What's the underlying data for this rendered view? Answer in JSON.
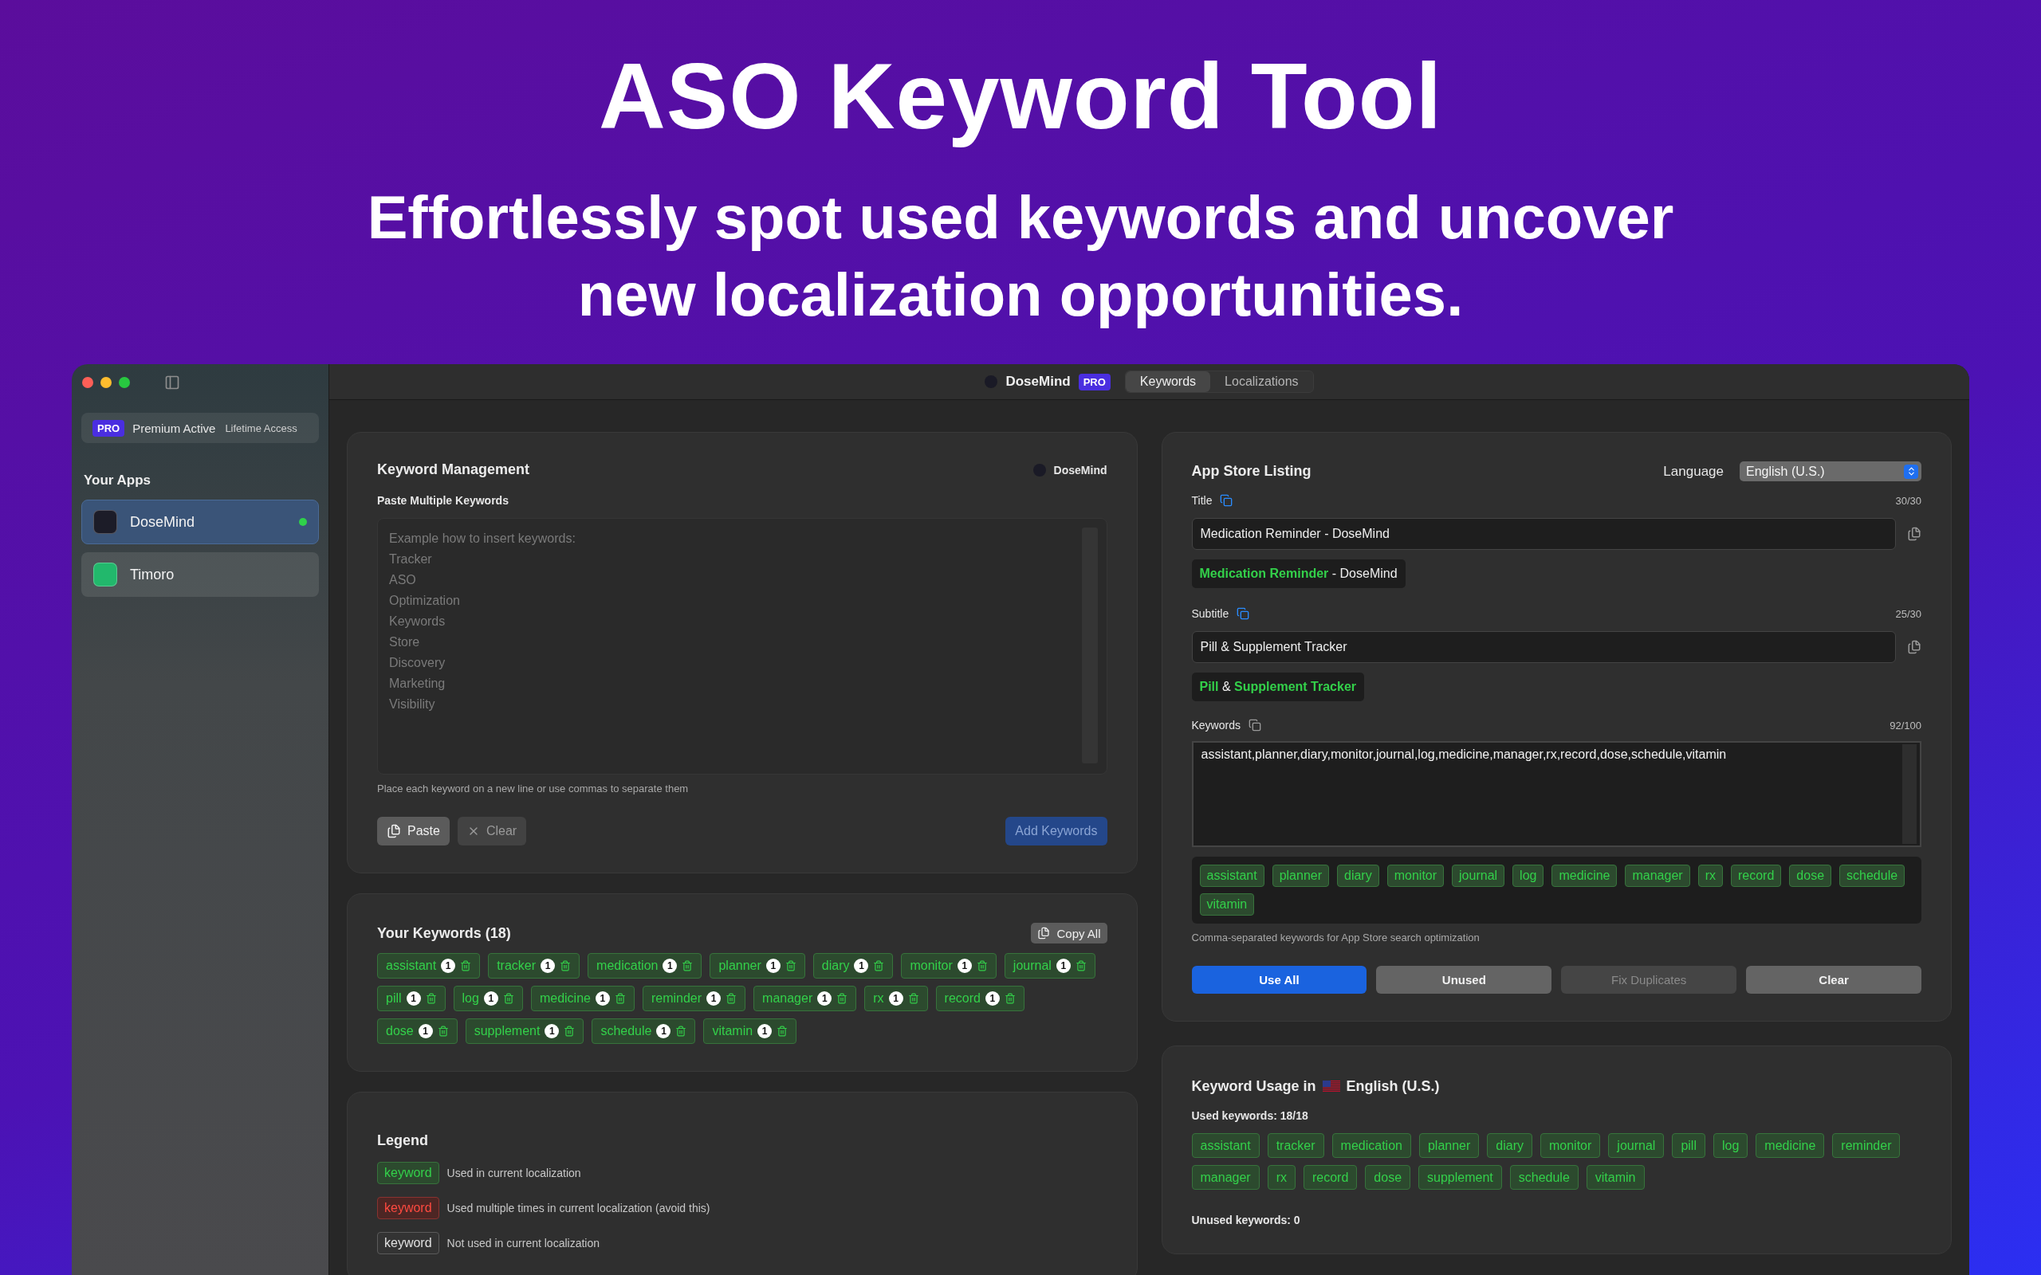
{
  "headline": "ASO Keyword Tool",
  "tagline": "Effortlessly spot used keywords and uncover new localization opportunities.",
  "window": {
    "sidebar": {
      "plan": {
        "badge": "PRO",
        "status": "Premium Active",
        "term": "Lifetime Access"
      },
      "section": "Your Apps",
      "apps": [
        {
          "name": "DoseMind",
          "color": "#1c1c28",
          "selected": true,
          "active": true
        },
        {
          "name": "Timoro",
          "color": "#22b86c",
          "selected": false,
          "active": false
        }
      ]
    },
    "toolbar": {
      "app": "DoseMind",
      "badge": "PRO",
      "tabs": [
        {
          "label": "Keywords",
          "selected": true
        },
        {
          "label": "Localizations",
          "selected": false
        }
      ]
    },
    "keyword_management": {
      "title": "Keyword Management",
      "app": "DoseMind",
      "label": "Paste Multiple Keywords",
      "placeholder": "Example how to insert keywords:\nTracker\nASO\nOptimization\nKeywords\nStore\nDiscovery\nMarketing\nVisibility",
      "hint": "Place each keyword on a new line or use commas to separate them",
      "buttons": [
        {
          "label": "Paste",
          "kind": "paste",
          "disabled": false
        },
        {
          "label": "Clear",
          "kind": "clear",
          "disabled": true
        },
        {
          "label": "Add Keywords",
          "kind": "primary",
          "disabled": true
        }
      ]
    },
    "your_keywords": {
      "title": "Your Keywords (18)",
      "copy_all": "Copy All",
      "keywords": [
        {
          "word": "assistant",
          "count": "1",
          "used": true
        },
        {
          "word": "tracker",
          "count": "1",
          "used": true
        },
        {
          "word": "medication",
          "count": "1",
          "used": true
        },
        {
          "word": "planner",
          "count": "1",
          "used": true
        },
        {
          "word": "diary",
          "count": "1",
          "used": true
        },
        {
          "word": "monitor",
          "count": "1",
          "used": true
        },
        {
          "word": "journal",
          "count": "1",
          "used": true
        },
        {
          "word": "pill",
          "count": "1",
          "used": true
        },
        {
          "word": "log",
          "count": "1",
          "used": true
        },
        {
          "word": "medicine",
          "count": "1",
          "used": true
        },
        {
          "word": "reminder",
          "count": "1",
          "used": true
        },
        {
          "word": "manager",
          "count": "1",
          "used": true
        },
        {
          "word": "rx",
          "count": "1",
          "used": true
        },
        {
          "word": "record",
          "count": "1",
          "used": true
        },
        {
          "word": "dose",
          "count": "1",
          "used": true
        },
        {
          "word": "supplement",
          "count": "1",
          "used": true
        },
        {
          "word": "schedule",
          "count": "1",
          "used": true
        },
        {
          "word": "vitamin",
          "count": "1",
          "used": true
        }
      ]
    },
    "legend": {
      "title": "Legend",
      "items": [
        {
          "sample": "keyword",
          "kind": "used",
          "text": "Used in current localization"
        },
        {
          "sample": "keyword",
          "kind": "duplicate",
          "text": "Used multiple times in current localization (avoid this)"
        },
        {
          "sample": "keyword",
          "kind": "unused",
          "text": "Not used in current localization"
        }
      ]
    },
    "listing": {
      "title": "App Store Listing",
      "language_label": "Language",
      "language": "English (U.S.)",
      "fields": [
        {
          "label": "Title",
          "copy_active": true,
          "counter": "30/30",
          "value": "Medication Reminder - DoseMind",
          "preview": [
            {
              "text": "Medication Reminder",
              "used": true
            },
            {
              "text": " - DoseMind",
              "used": false
            }
          ]
        },
        {
          "label": "Subtitle",
          "copy_active": true,
          "counter": "25/30",
          "value": "Pill & Supplement Tracker",
          "preview": [
            {
              "text": "Pill",
              "used": true
            },
            {
              "text": " & ",
              "used": false
            },
            {
              "text": "Supplement Tracker",
              "used": true
            }
          ]
        }
      ],
      "keywords": {
        "label": "Keywords",
        "copy_active": false,
        "counter": "92/100",
        "value": "assistant,planner,diary,monitor,journal,log,medicine,manager,rx,record,dose,schedule,vitamin",
        "chips": [
          {
            "word": "assistant",
            "used": true
          },
          {
            "word": "planner",
            "used": true
          },
          {
            "word": "diary",
            "used": true
          },
          {
            "word": "monitor",
            "used": true
          },
          {
            "word": "journal",
            "used": true
          },
          {
            "word": "log",
            "used": true
          },
          {
            "word": "medicine",
            "used": true
          },
          {
            "word": "manager",
            "used": true
          },
          {
            "word": "rx",
            "used": true
          },
          {
            "word": "record",
            "used": true
          },
          {
            "word": "dose",
            "used": true
          },
          {
            "word": "schedule",
            "used": true
          },
          {
            "word": "vitamin",
            "used": true
          }
        ],
        "hint": "Comma-separated keywords for App Store search optimization"
      },
      "buttons": [
        {
          "label": "Use All",
          "kind": "primary",
          "disabled": false
        },
        {
          "label": "Unused",
          "kind": "secondary",
          "disabled": false
        },
        {
          "label": "Fix Duplicates",
          "kind": "secondary",
          "disabled": true
        },
        {
          "label": "Clear",
          "kind": "secondary",
          "disabled": false
        }
      ]
    },
    "usage": {
      "title": "Keyword Usage in",
      "language": "English (U.S.)",
      "used_label": "Used keywords: 18/18",
      "used": [
        {
          "word": "assistant",
          "used": true
        },
        {
          "word": "tracker",
          "used": true
        },
        {
          "word": "medication",
          "used": true
        },
        {
          "word": "planner",
          "used": true
        },
        {
          "word": "diary",
          "used": true
        },
        {
          "word": "monitor",
          "used": true
        },
        {
          "word": "journal",
          "used": true
        },
        {
          "word": "pill",
          "used": true
        },
        {
          "word": "log",
          "used": true
        },
        {
          "word": "medicine",
          "used": true
        },
        {
          "word": "reminder",
          "used": true
        },
        {
          "word": "manager",
          "used": true
        },
        {
          "word": "rx",
          "used": true
        },
        {
          "word": "record",
          "used": true
        },
        {
          "word": "dose",
          "used": true
        },
        {
          "word": "supplement",
          "used": true
        },
        {
          "word": "schedule",
          "used": true
        },
        {
          "word": "vitamin",
          "used": true
        }
      ],
      "unused_label": "Unused keywords: 0"
    }
  }
}
